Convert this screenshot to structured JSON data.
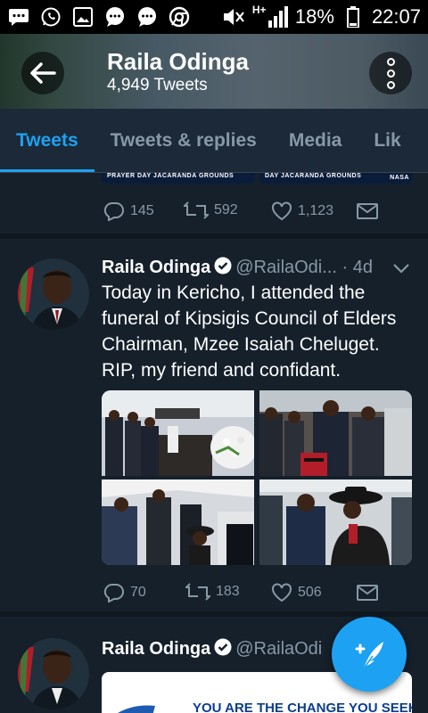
{
  "status_bar": {
    "icons": [
      "message-icon",
      "whatsapp-icon",
      "gallery-icon",
      "chat-icon",
      "chat-icon",
      "chrome-icon",
      "mute-icon",
      "signal-icon",
      "battery-icon"
    ],
    "network": "H+",
    "battery": "18%",
    "time": "22:07"
  },
  "header": {
    "name": "Raila Odinga",
    "tweet_count": "4,949 Tweets"
  },
  "tabs": [
    {
      "label": "Tweets",
      "active": true
    },
    {
      "label": "Tweets & replies",
      "active": false
    },
    {
      "label": "Media",
      "active": false
    },
    {
      "label": "Lik",
      "active": false
    }
  ],
  "prev_tweet": {
    "image_left_text": "PRAYER DAY JACARANDA GROUNDS",
    "image_right_text": "DAY JACARANDA GROUNDS",
    "logo_text": "NASA",
    "replies": "145",
    "retweets": "592",
    "likes": "1,123"
  },
  "tweet1": {
    "name": "Raila Odinga",
    "handle": "@RailaOdi...",
    "time": "· 4d",
    "text": "Today in Kericho, I attended the funeral of Kipsigis Council of Elders Chairman, Mzee Isaiah Cheluget. RIP, my friend and confidant.",
    "replies": "70",
    "retweets": "183",
    "likes": "506"
  },
  "tweet2": {
    "name": "Raila Odinga",
    "handle": "@RailaOdi",
    "card_text": "YOU ARE THE CHANGE YOU SEEK"
  },
  "colors": {
    "background": "#15202b",
    "accent": "#1da1f2",
    "muted": "#8899a6"
  }
}
